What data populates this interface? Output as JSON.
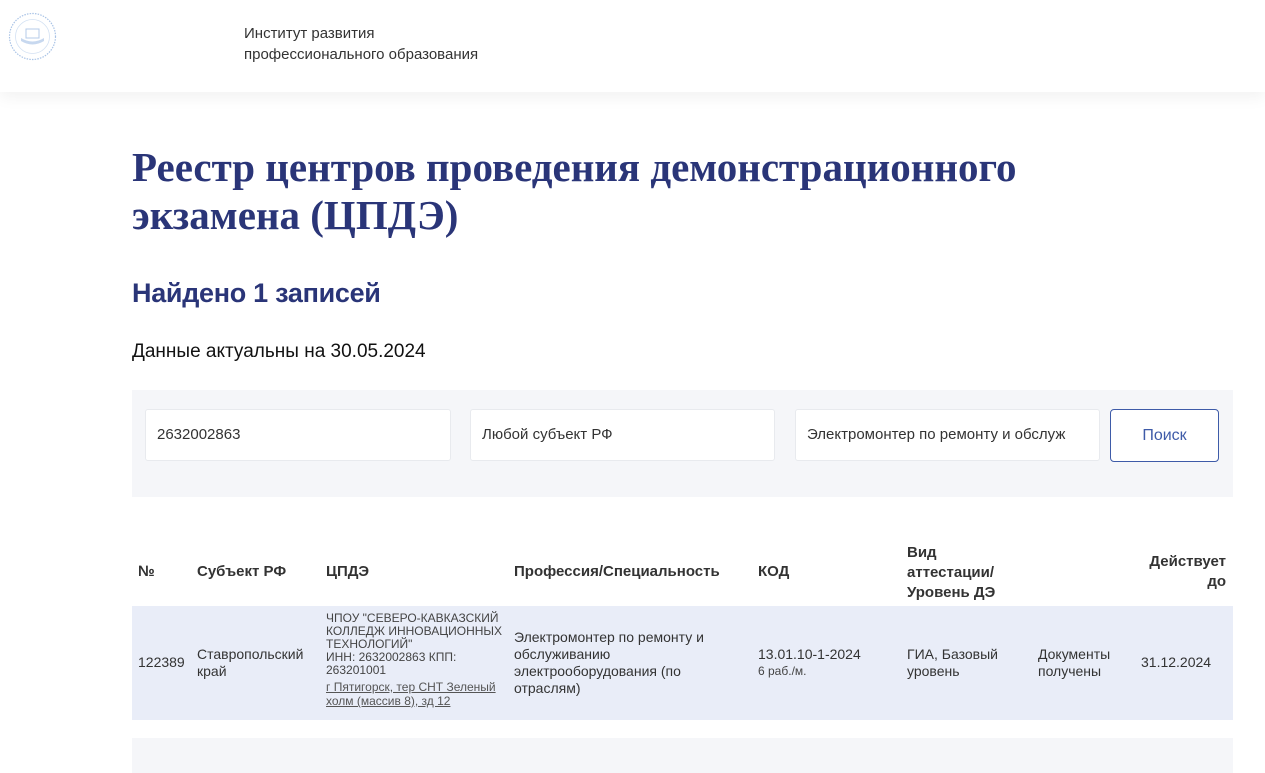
{
  "header": {
    "org_line1": "Институт развития",
    "org_line2": "профессионального образования"
  },
  "page": {
    "title": "Реестр центров проведения демонстрационного экзамена (ЦПДЭ)",
    "found": "Найдено 1 записей",
    "updated": "Данные актуальны на 30.05.2024"
  },
  "filters": {
    "inn_value": "2632002863",
    "region_value": "Любой субъект РФ",
    "profession_value": "Электромонтер по ремонту и обслуж",
    "search_label": "Поиск"
  },
  "table": {
    "headers": {
      "num": "№",
      "region": "Субъект РФ",
      "center": "ЦПДЭ",
      "profession": "Профессия/Специальность",
      "code": "КОД",
      "type_l1": "Вид",
      "type_l2": "аттестации/",
      "type_l3": "Уровень ДЭ",
      "valid_l1": "Действует",
      "valid_l2": "до"
    },
    "rows": [
      {
        "num": "122389",
        "region_l1": "Ставропольский",
        "region_l2": "край",
        "center_l1": "ЧПОУ \"СЕВЕРО-КАВКАЗСКИЙ",
        "center_l2": "КОЛЛЕДЖ ИННОВАЦИОННЫХ",
        "center_l3": "ТЕХНОЛОГИЙ\"",
        "center_l4": "ИНН: 2632002863 КПП:",
        "center_l5": "263201001",
        "addr_l1": "г Пятигорск, тер СНТ Зеленый",
        "addr_l2": "холм (массив 8), зд 12",
        "prof_l1": "Электромонтер по ремонту и",
        "prof_l2": "обслуживанию",
        "prof_l3": "электрооборудования (по",
        "prof_l4": "отраслям)",
        "code": "13.01.10-1-2024",
        "code_sub": "6 раб./м.",
        "type_l1": "ГИА, Базовый",
        "type_l2": "уровень",
        "status_l1": "Документы",
        "status_l2": "получены",
        "valid": "31.12.2024"
      }
    ]
  }
}
